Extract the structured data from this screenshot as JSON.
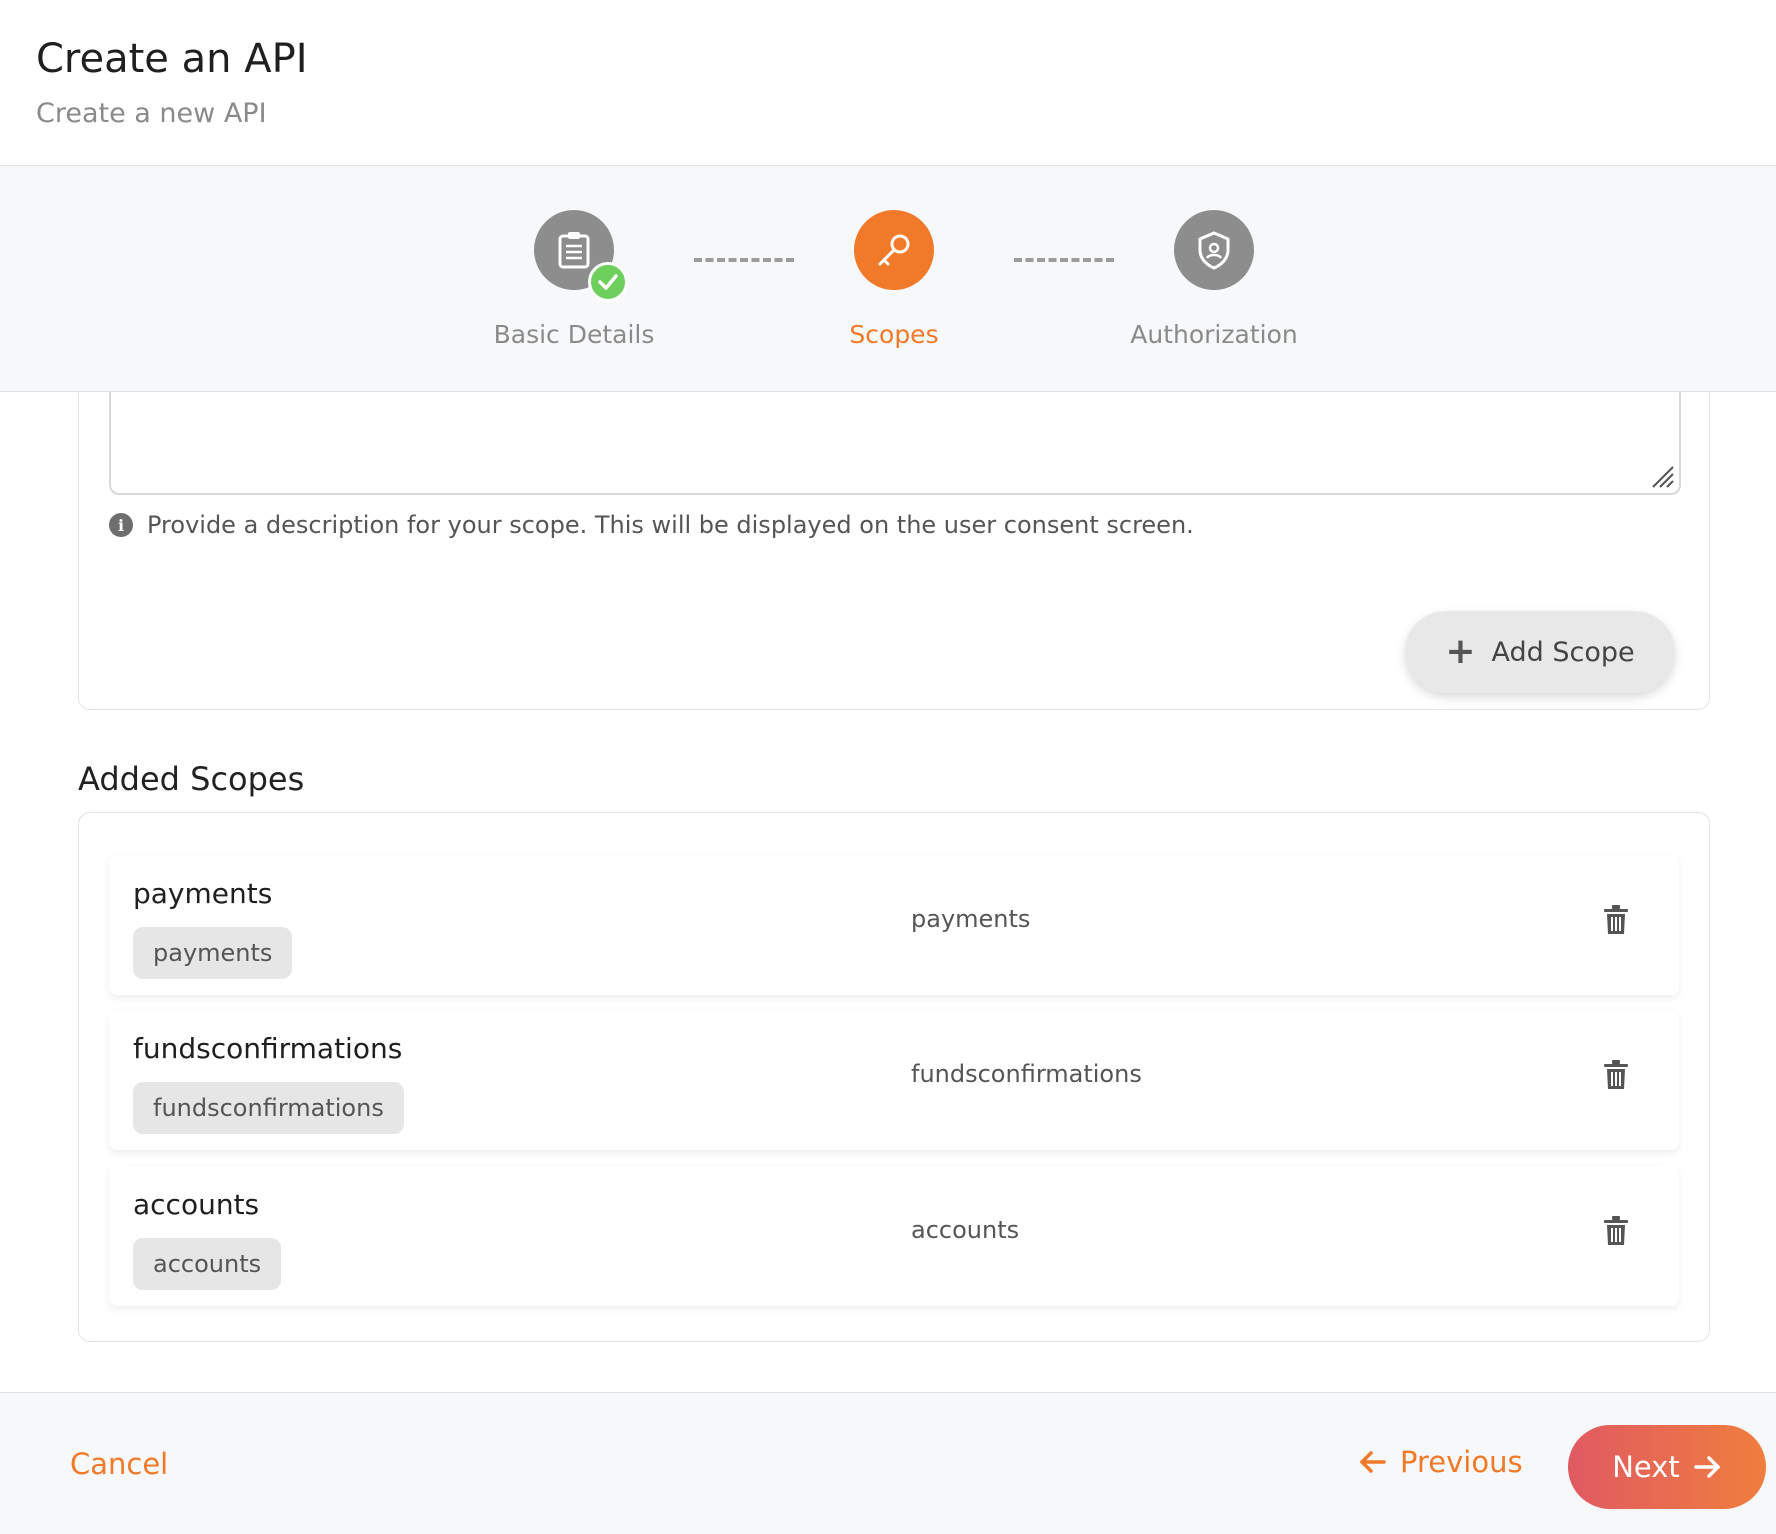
{
  "header": {
    "title": "Create an API",
    "subtitle": "Create a new API"
  },
  "stepper": {
    "steps": [
      {
        "label": "Basic Details",
        "state": "completed",
        "icon": "clipboard-icon"
      },
      {
        "label": "Scopes",
        "state": "active",
        "icon": "key-icon"
      },
      {
        "label": "Authorization",
        "state": "pending",
        "icon": "shield-icon"
      }
    ]
  },
  "scope_form": {
    "hint": "Provide a description for your scope. This will be displayed on the user consent screen.",
    "add_button": "Add Scope"
  },
  "added_scopes": {
    "title": "Added Scopes",
    "items": [
      {
        "name": "payments",
        "chip": "payments",
        "description": "payments"
      },
      {
        "name": "fundsconfirmations",
        "chip": "fundsconfirmations",
        "description": "fundsconfirmations"
      },
      {
        "name": "accounts",
        "chip": "accounts",
        "description": "accounts"
      }
    ]
  },
  "footer": {
    "cancel": "Cancel",
    "previous": "Previous",
    "next": "Next"
  },
  "colors": {
    "accent": "#f07a2a",
    "success": "#6fcf5d",
    "next_gradient_start": "#e05a62",
    "next_gradient_end": "#f07e3e"
  }
}
